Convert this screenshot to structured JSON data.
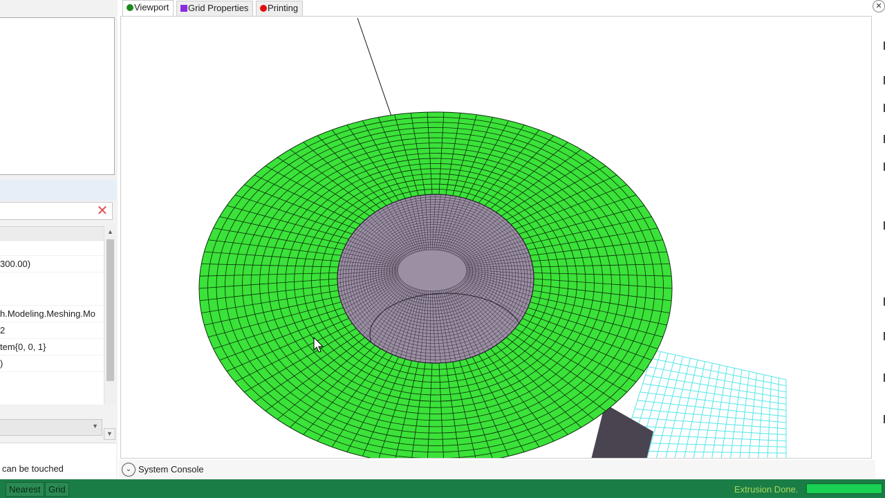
{
  "tabs": [
    {
      "label": "Viewport",
      "color": "#1a8a1a",
      "marker": "circle"
    },
    {
      "label": "Grid Properties",
      "color": "#8a2be2",
      "marker": "square"
    },
    {
      "label": "Printing",
      "color": "#e01010",
      "marker": "circle"
    }
  ],
  "left_panel": {
    "properties": [
      {
        "text": ""
      },
      {
        "text": "300.00)"
      },
      {
        "text": ""
      },
      {
        "text": "h.Modeling.Meshing.Mo"
      },
      {
        "text": "2"
      },
      {
        "text": "tem{0, 0, 1}"
      },
      {
        "text": ")"
      }
    ],
    "help_text": "can be touched"
  },
  "console": {
    "label": "System Console"
  },
  "statusbar": {
    "nearest_label": "Nearest",
    "grid_label": "Grid",
    "message": "Extrusion Done.",
    "progress": 1.0
  },
  "colors": {
    "mesh_green": "#3be239",
    "mesh_purple": "#9b8fa3",
    "grid_cyan": "#55e6e8",
    "status_green": "#1b7d46"
  },
  "icons": {
    "clear": "x-icon",
    "console_toggle": "chevron-down-icon",
    "close": "close-icon"
  }
}
